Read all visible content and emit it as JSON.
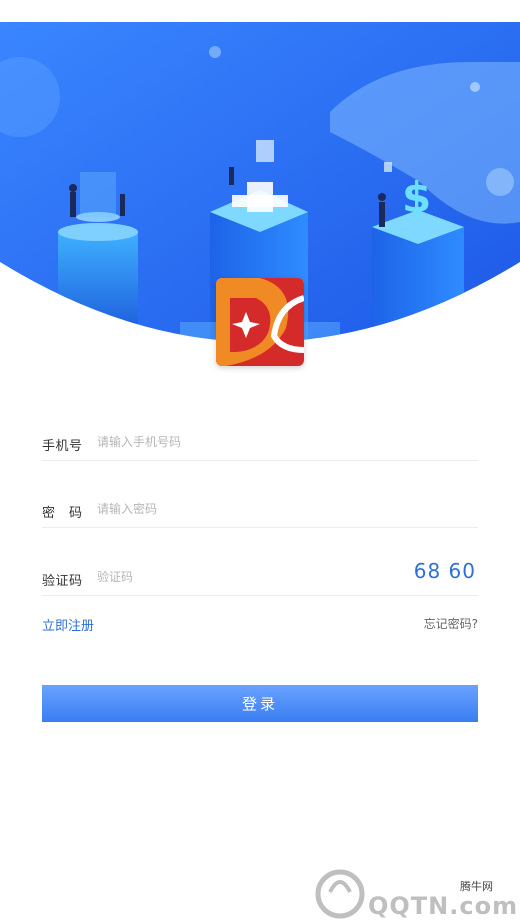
{
  "hero": {
    "illustration": "fintech-city-illustration",
    "colors": {
      "primary": "#2f7cf6",
      "dark": "#1a4fd0",
      "light": "#8ec2ff"
    }
  },
  "logo": {
    "icon": "app-logo-icon",
    "colors": {
      "red": "#d42a2a",
      "orange": "#f08a24"
    }
  },
  "form": {
    "phone": {
      "label": "手机号",
      "placeholder": "请输入手机号码",
      "value": ""
    },
    "password": {
      "label": "密　码",
      "placeholder": "请输入密码",
      "value": ""
    },
    "code": {
      "label": "验证码",
      "placeholder": "验证码",
      "value": "",
      "captcha": "68 60"
    }
  },
  "links": {
    "register": "立即注册",
    "forgot": "忘记密码?"
  },
  "login": {
    "label": "登录",
    "color": "#3a7ef2"
  },
  "watermark": {
    "site": "腾牛网",
    "text": "QQTN.com"
  }
}
